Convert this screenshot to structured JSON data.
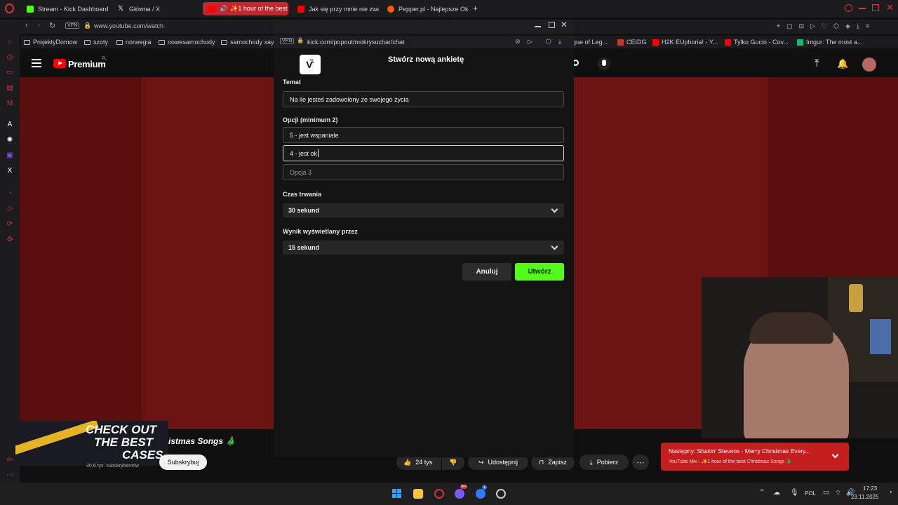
{
  "browser": {
    "tabs": [
      {
        "title": "Stream - Kick Dashboard",
        "icon": "kick-icon",
        "color": "#53fc18"
      },
      {
        "title": "Główna / X",
        "icon": "x-icon",
        "color": "#ffffff"
      },
      {
        "title": "✨1 hour of the best c",
        "icon": "youtube-icon",
        "color": "#ff0000"
      },
      {
        "title": "Jak się przy mnie nie zwa",
        "icon": "youtube-icon",
        "color": "#ff0000"
      },
      {
        "title": "Pepper.pl - Najlepsze Ok",
        "icon": "pepper-icon",
        "color": "#ff5c00"
      }
    ],
    "new_tab": "+",
    "url": "www.youtube.com/watch",
    "vpn": "VPN",
    "bookmarks": [
      "ProjektyDomow",
      "szoty",
      "norwegia",
      "nowesamochody",
      "samochody xayc"
    ],
    "bookmarks_right": [
      "gue of Leg...",
      "CEIDG",
      "H2K EUphoria! - Y...",
      "Tylko Gucio - Cov...",
      "Imgur: The most a..."
    ]
  },
  "popup": {
    "vpn": "VPN",
    "url": "kick.com/popout/mokrysuchar/chat",
    "title": "Stwórz nową ankietę",
    "topic_label": "Temat",
    "topic_value": "Na ile jesteś zadowolony ze swojego życia",
    "options_label": "Opcji (minimum 2)",
    "option1": "5 - jest wspaniale",
    "option2": "4 - jest ok",
    "option3_placeholder": "Opcja 3",
    "duration_label": "Czas trwania",
    "duration_value": "30 sekund",
    "result_label": "Wynik wyświetlany przez",
    "result_value": "15 sekund",
    "cancel": "Anuluj",
    "create": "Utwórz",
    "accent": "#53fc18"
  },
  "youtube": {
    "brand": "Premium",
    "region": "PL",
    "video_title_fragment": "istmas Songs 🎄",
    "subscribers": "30,6 tys. subskrybentów",
    "subscribe": "Subskrybuj",
    "likes": "24 tys.",
    "share": "Udostępnij",
    "save": "Zapisz",
    "download": "Pobierz",
    "ad_line1": "CHECK OUT",
    "ad_line2": "THE BEST",
    "ad_line3": "CASES",
    "next_label": "Następny: Shakin' Stevens - Merry Christmas Every...",
    "next_sub": "YouTube Mix - ✨1 hour of the best Christmas Songs 🎄"
  },
  "taskbar": {
    "lang": "POL",
    "time": "17:23",
    "date": "23.11.2025",
    "badge1": "99+",
    "badge2": "1"
  }
}
